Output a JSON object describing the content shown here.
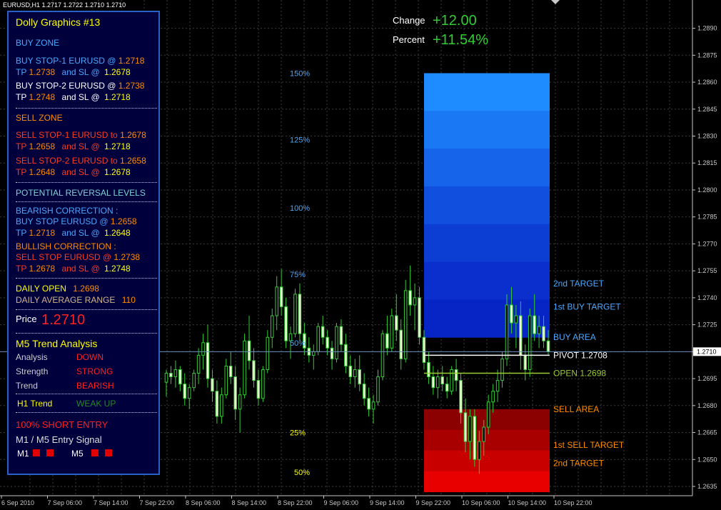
{
  "symbol_line": "EURUSD,H1  1.2717 1.2722 1.2710 1.2710",
  "change": {
    "label": "Change",
    "value": "+12.00"
  },
  "percent": {
    "label": "Percent",
    "value": "+11.54%"
  },
  "panel": {
    "title": "Dolly Graphics #13",
    "buy_zone": "BUY ZONE",
    "buy1_a": "BUY STOP-1  EURUSD  @",
    "buy1_price": "1.2718",
    "buy1_tp_label": "TP",
    "buy1_tp": "1.2738",
    "buy1_sl_label": "and SL @",
    "buy1_sl": "1.2678",
    "buy2_a": "BUY STOP-2  EURUSD  @",
    "buy2_price": "1.2738",
    "buy2_tp_label": "TP",
    "buy2_tp": "1.2748",
    "buy2_sl_label": "and SL @",
    "buy2_sl": "1.2718",
    "sell_zone": "SELL ZONE",
    "sell1_a": "SELL STOP-1  EURUSD to",
    "sell1_price": "1.2678",
    "sell1_tp_label": "TP",
    "sell1_tp": "1.2658",
    "sell1_sl_label": "and SL @",
    "sell1_sl": "1.2718",
    "sell2_a": "SELL STOP-2  EURUSD to",
    "sell2_price": "1.2658",
    "sell2_tp_label": "TP",
    "sell2_tp": "1.2648",
    "sell2_sl_label": "and SL @",
    "sell2_sl": "1.2678",
    "reversal_title": "POTENTIAL REVERSAL LEVELS",
    "bear_title": "BEARISH CORRECTION :",
    "bear_a": "BUY STOP EURUSD  @",
    "bear_price": "1.2658",
    "bear_tp_label": "TP",
    "bear_tp": "1.2718",
    "bear_sl_label": "and SL @",
    "bear_sl": "1.2648",
    "bull_title": "BULLISH CORRECTION :",
    "bull_a": "SELL STOP EURUSD  @",
    "bull_price": "1.2738",
    "bull_tp_label": "TP",
    "bull_tp": "1.2678",
    "bull_sl_label": "and SL @",
    "bull_sl": "1.2748",
    "daily_open_label": "DAILY OPEN",
    "daily_open": "1.2698",
    "dar_label": "DAILY AVERAGE RANGE",
    "dar": "110",
    "price_label": "Price",
    "price": "1.2710",
    "m5_title": "M5 Trend Analysis",
    "analysis_label": "Analysis",
    "analysis": "DOWN",
    "strength_label": "Strength",
    "strength": "STRONG",
    "trend_label": "Trend",
    "trend": "BEARISH",
    "h1_label": "H1 Trend",
    "h1": "WEAK UP",
    "entry": "100% SHORT ENTRY",
    "signal_title": "M1 /  M5 Entry Signal",
    "m1_label": "M1",
    "m5_label": "M5"
  },
  "colors": {
    "bg": "#000000",
    "grid": "#3b3b3b",
    "candle_up": "#000000",
    "candle_down": "#f0ffd8",
    "wick": "#32cd32",
    "panel_bg": "#00003d",
    "blue_text": "#4aa8ff",
    "orange": "#ff8c00",
    "red_text": "#ff3c1e",
    "yellow": "#ffff00",
    "white": "#ffffff",
    "green": "#32cd32"
  },
  "chart_data": {
    "type": "candlestick",
    "ylim": [
      1.2635,
      1.2895
    ],
    "y_ticks": [
      "1.2890",
      "1.2875",
      "1.2860",
      "1.2845",
      "1.2830",
      "1.2815",
      "1.2800",
      "1.2785",
      "1.2770",
      "1.2755",
      "1.2740",
      "1.2725",
      "1.2710",
      "1.2695",
      "1.2680",
      "1.2665",
      "1.2650",
      "1.2635"
    ],
    "current_price": "1.2710",
    "x_ticks": [
      "6 Sep 2010",
      "7 Sep 06:00",
      "7 Sep 14:00",
      "7 Sep 22:00",
      "8 Sep 06:00",
      "8 Sep 14:00",
      "8 Sep 22:00",
      "9 Sep 06:00",
      "9 Sep 14:00",
      "9 Sep 22:00",
      "10 Sep 06:00",
      "10 Sep 14:00",
      "10 Sep 22:00"
    ],
    "fib_upper": [
      {
        "label": "150%",
        "price": 1.2865
      },
      {
        "label": "125%",
        "price": 1.2828
      },
      {
        "label": "100%",
        "price": 1.279
      },
      {
        "label": "75%",
        "price": 1.2753
      },
      {
        "label": "50%",
        "price": 1.2715
      },
      {
        "label": "25%",
        "price": 1.2665
      }
    ],
    "fib_lower": [
      {
        "label": "50%",
        "price": 1.2643
      }
    ],
    "buy_box": {
      "top": 1.2865,
      "bottom": 1.2718
    },
    "sell_box": {
      "top": 1.2678,
      "bottom": 1.2632
    },
    "levels": [
      {
        "label": "2nd TARGET",
        "price": 1.2748,
        "color": "#4aa8ff",
        "line": false
      },
      {
        "label": "1st BUY TARGET",
        "price": 1.2735,
        "color": "#4aa8ff",
        "line": false
      },
      {
        "label": "BUY AREA",
        "price": 1.2718,
        "color": "#4aa8ff",
        "line": false
      },
      {
        "label": "PIVOT 1.2708",
        "price": 1.2708,
        "color": "#ffffff",
        "line": true
      },
      {
        "label": "OPEN 1.2698",
        "price": 1.2698,
        "color": "#9acd32",
        "line": true
      },
      {
        "label": "SELL AREA",
        "price": 1.2678,
        "color": "#ff8c00",
        "line": false
      },
      {
        "label": "1st SELL TARGET",
        "price": 1.2658,
        "color": "#ff8c00",
        "line": false
      },
      {
        "label": "2nd TARGET",
        "price": 1.2648,
        "color": "#ff8c00",
        "line": false
      }
    ],
    "candles": [
      [
        1.2693,
        1.27,
        1.2685,
        1.2698
      ],
      [
        1.2698,
        1.2702,
        1.2692,
        1.2696
      ],
      [
        1.2696,
        1.2705,
        1.269,
        1.27
      ],
      [
        1.27,
        1.2702,
        1.2688,
        1.2692
      ],
      [
        1.2692,
        1.2698,
        1.268,
        1.2684
      ],
      [
        1.2684,
        1.2692,
        1.2678,
        1.269
      ],
      [
        1.269,
        1.27,
        1.2688,
        1.2698
      ],
      [
        1.2698,
        1.2712,
        1.2692,
        1.2708
      ],
      [
        1.2708,
        1.272,
        1.27,
        1.2715
      ],
      [
        1.2715,
        1.2725,
        1.269,
        1.2695
      ],
      [
        1.2695,
        1.27,
        1.2682,
        1.2688
      ],
      [
        1.2688,
        1.2694,
        1.267,
        1.2674
      ],
      [
        1.2674,
        1.269,
        1.267,
        1.2686
      ],
      [
        1.2686,
        1.2706,
        1.2684,
        1.2702
      ],
      [
        1.2702,
        1.271,
        1.2692,
        1.2696
      ],
      [
        1.2696,
        1.2702,
        1.2672,
        1.2678
      ],
      [
        1.2678,
        1.269,
        1.2665,
        1.2686
      ],
      [
        1.2686,
        1.272,
        1.2684,
        1.2716
      ],
      [
        1.2716,
        1.273,
        1.27,
        1.2705
      ],
      [
        1.2705,
        1.2712,
        1.269,
        1.2694
      ],
      [
        1.2694,
        1.27,
        1.268,
        1.2684
      ],
      [
        1.2684,
        1.2702,
        1.2682,
        1.27
      ],
      [
        1.27,
        1.2722,
        1.2698,
        1.2718
      ],
      [
        1.2718,
        1.2734,
        1.2712,
        1.273
      ],
      [
        1.273,
        1.2752,
        1.2722,
        1.2746
      ],
      [
        1.2746,
        1.2756,
        1.273,
        1.2735
      ],
      [
        1.2735,
        1.274,
        1.2712,
        1.2716
      ],
      [
        1.2716,
        1.2724,
        1.2706,
        1.272
      ],
      [
        1.272,
        1.2745,
        1.2718,
        1.2742
      ],
      [
        1.2742,
        1.2748,
        1.2716,
        1.272
      ],
      [
        1.272,
        1.2726,
        1.2708,
        1.2712
      ],
      [
        1.2712,
        1.2718,
        1.2704,
        1.2708
      ],
      [
        1.2708,
        1.2714,
        1.27,
        1.271
      ],
      [
        1.271,
        1.2726,
        1.2708,
        1.2724
      ],
      [
        1.2724,
        1.273,
        1.2714,
        1.2718
      ],
      [
        1.2718,
        1.2722,
        1.2708,
        1.2712
      ],
      [
        1.2712,
        1.2716,
        1.27,
        1.2706
      ],
      [
        1.2706,
        1.2726,
        1.2704,
        1.2724
      ],
      [
        1.2724,
        1.2728,
        1.271,
        1.2714
      ],
      [
        1.2714,
        1.272,
        1.2698,
        1.2702
      ],
      [
        1.2702,
        1.2708,
        1.2692,
        1.2696
      ],
      [
        1.2696,
        1.2706,
        1.269,
        1.27
      ],
      [
        1.27,
        1.2708,
        1.2688,
        1.2692
      ],
      [
        1.2692,
        1.2698,
        1.268,
        1.2684
      ],
      [
        1.2684,
        1.269,
        1.2674,
        1.2678
      ],
      [
        1.2678,
        1.2686,
        1.267,
        1.2682
      ],
      [
        1.2682,
        1.27,
        1.268,
        1.2696
      ],
      [
        1.2696,
        1.2722,
        1.2694,
        1.272
      ],
      [
        1.272,
        1.273,
        1.2708,
        1.2712
      ],
      [
        1.2712,
        1.2734,
        1.271,
        1.273
      ],
      [
        1.273,
        1.2742,
        1.2716,
        1.2722
      ],
      [
        1.2722,
        1.2728,
        1.27,
        1.2706
      ],
      [
        1.2706,
        1.275,
        1.2704,
        1.2744
      ],
      [
        1.2744,
        1.2758,
        1.273,
        1.2736
      ],
      [
        1.2736,
        1.2748,
        1.2722,
        1.274
      ],
      [
        1.274,
        1.2746,
        1.2714,
        1.2718
      ],
      [
        1.2718,
        1.2722,
        1.27,
        1.2704
      ],
      [
        1.2704,
        1.271,
        1.2692,
        1.2696
      ],
      [
        1.2696,
        1.2702,
        1.2686,
        1.269
      ],
      [
        1.269,
        1.27,
        1.2684,
        1.2696
      ],
      [
        1.2696,
        1.2702,
        1.2688,
        1.2692
      ],
      [
        1.2692,
        1.2696,
        1.2684,
        1.2688
      ],
      [
        1.2688,
        1.2702,
        1.2686,
        1.27
      ],
      [
        1.27,
        1.2706,
        1.2688,
        1.2694
      ],
      [
        1.2694,
        1.2698,
        1.267,
        1.2676
      ],
      [
        1.2676,
        1.2684,
        1.2654,
        1.266
      ],
      [
        1.266,
        1.2678,
        1.265,
        1.2674
      ],
      [
        1.2674,
        1.2678,
        1.2646,
        1.265
      ],
      [
        1.265,
        1.2666,
        1.2642,
        1.266
      ],
      [
        1.266,
        1.2672,
        1.2652,
        1.2668
      ],
      [
        1.2668,
        1.2686,
        1.2664,
        1.2682
      ],
      [
        1.2682,
        1.2692,
        1.2676,
        1.2688
      ],
      [
        1.2688,
        1.27,
        1.2682,
        1.2694
      ],
      [
        1.2694,
        1.271,
        1.269,
        1.2706
      ],
      [
        1.2706,
        1.2742,
        1.2702,
        1.2736
      ],
      [
        1.2736,
        1.2746,
        1.272,
        1.2726
      ],
      [
        1.2726,
        1.2736,
        1.2712,
        1.273
      ],
      [
        1.273,
        1.2738,
        1.27,
        1.2708
      ],
      [
        1.2708,
        1.2714,
        1.2694,
        1.27
      ],
      [
        1.27,
        1.2734,
        1.2696,
        1.273
      ],
      [
        1.273,
        1.2742,
        1.2716,
        1.272
      ],
      [
        1.272,
        1.273,
        1.2712,
        1.2724
      ],
      [
        1.2724,
        1.273,
        1.2712,
        1.2716
      ],
      [
        1.2716,
        1.2722,
        1.2708,
        1.271
      ]
    ]
  }
}
